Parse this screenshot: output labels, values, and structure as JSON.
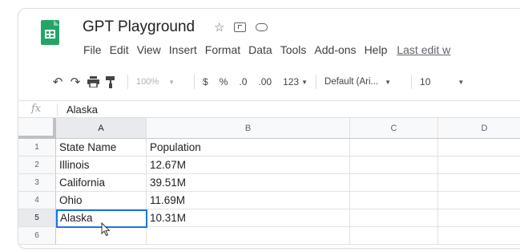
{
  "app": {
    "title": "GPT Playground",
    "icons": [
      "star-icon",
      "move-to-folder-icon",
      "cloud-status-icon"
    ],
    "brand_color": "#23a566"
  },
  "menu": {
    "items": [
      "File",
      "Edit",
      "View",
      "Insert",
      "Format",
      "Data",
      "Tools",
      "Add-ons",
      "Help"
    ],
    "last_edit": "Last edit w"
  },
  "toolbar": {
    "icons": [
      "undo-icon",
      "redo-icon",
      "print-icon",
      "paint-format-icon"
    ],
    "zoom": "100%",
    "currency": "$",
    "percent": "%",
    "decrease_decimal": ".0",
    "increase_decimal": ".00",
    "more_formats": "123",
    "font": "Default (Ari...",
    "font_size": "10"
  },
  "formula_bar": {
    "fx_label": "fx",
    "value": "Alaska"
  },
  "grid": {
    "columns": [
      "A",
      "B",
      "C",
      "D"
    ],
    "rows": [
      "1",
      "2",
      "3",
      "4",
      "5",
      "6"
    ],
    "cells": [
      [
        "State Name",
        "Population",
        "",
        ""
      ],
      [
        "Illinois",
        "12.67M",
        "",
        ""
      ],
      [
        "California",
        "39.51M",
        "",
        ""
      ],
      [
        "Ohio",
        "11.69M",
        "",
        ""
      ],
      [
        "Alaska",
        "10.31M",
        "",
        ""
      ],
      [
        "",
        "",
        "",
        ""
      ]
    ],
    "active_cell": "A5",
    "selection_color": "#1a73e8"
  }
}
